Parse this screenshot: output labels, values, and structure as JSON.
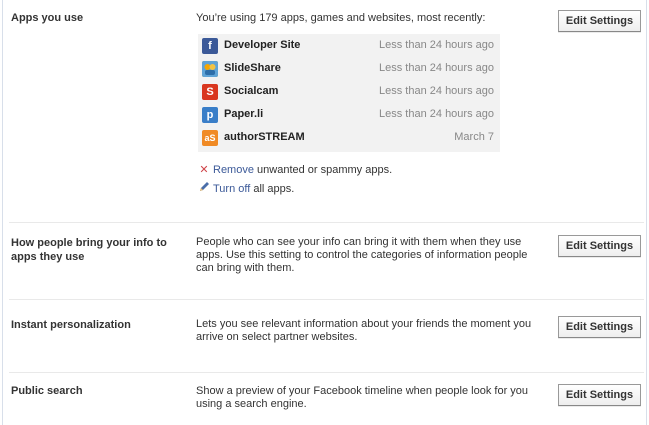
{
  "sections": [
    {
      "title": "Apps you use",
      "desc": "You’re using 179 apps, games and websites, most recently:",
      "button": "Edit Settings"
    },
    {
      "title": "How people bring your info to apps they use",
      "desc": "People who can see your info can bring it with them when they use apps. Use this setting to control the categories of information people can bring with them.",
      "button": "Edit Settings"
    },
    {
      "title": "Instant personalization",
      "desc": "Lets you see relevant information about your friends the moment you arrive on select partner websites.",
      "button": "Edit Settings"
    },
    {
      "title": "Public search",
      "desc": "Show a preview of your Facebook timeline when people look for you using a search engine.",
      "button": "Edit Settings"
    }
  ],
  "apps": [
    {
      "name": "Developer Site",
      "time": "Less than 24 hours ago",
      "icon": "developer-site-icon",
      "color": "#3b5998"
    },
    {
      "name": "SlideShare",
      "time": "Less than 24 hours ago",
      "icon": "slideshare-icon",
      "color": "#f7a600"
    },
    {
      "name": "Socialcam",
      "time": "Less than 24 hours ago",
      "icon": "socialcam-icon",
      "color": "#d9361f"
    },
    {
      "name": "Paper.li",
      "time": "Less than 24 hours ago",
      "icon": "paperli-icon",
      "color": "#3a7ec8"
    },
    {
      "name": "authorSTREAM",
      "time": "March 7",
      "icon": "authorstream-icon",
      "color": "#f08a24"
    }
  ],
  "remove_line": {
    "link": "Remove",
    "rest": " unwanted or spammy apps."
  },
  "turnoff_line": {
    "link": "Turn off",
    "rest": " all apps."
  }
}
